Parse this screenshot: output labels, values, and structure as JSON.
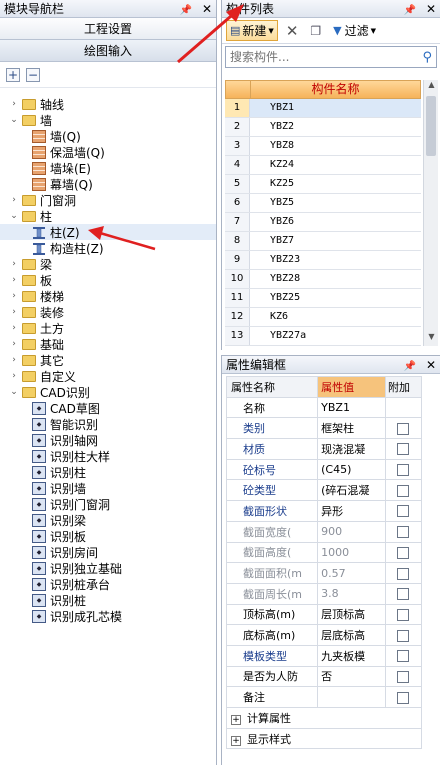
{
  "left_panel": {
    "title": "模块导航栏",
    "tabs": [
      "工程设置",
      "绘图输入"
    ],
    "tree": [
      {
        "label": "轴线",
        "type": "folder",
        "state": "collapsed",
        "level": 0
      },
      {
        "label": "墙",
        "type": "folder",
        "state": "expanded",
        "level": 0
      },
      {
        "label": "墙(Q)",
        "type": "wall",
        "level": 1
      },
      {
        "label": "保温墙(Q)",
        "type": "wall",
        "level": 1
      },
      {
        "label": "墙垛(E)",
        "type": "wall",
        "level": 1
      },
      {
        "label": "幕墙(Q)",
        "type": "wall",
        "level": 1
      },
      {
        "label": "门窗洞",
        "type": "folder",
        "state": "collapsed",
        "level": 0
      },
      {
        "label": "柱",
        "type": "folder",
        "state": "expanded",
        "level": 0
      },
      {
        "label": "柱(Z)",
        "type": "column",
        "level": 1,
        "selected": true
      },
      {
        "label": "构造柱(Z)",
        "type": "column",
        "level": 1
      },
      {
        "label": "梁",
        "type": "folder",
        "state": "collapsed",
        "level": 0
      },
      {
        "label": "板",
        "type": "folder",
        "state": "collapsed",
        "level": 0
      },
      {
        "label": "楼梯",
        "type": "folder",
        "state": "collapsed",
        "level": 0
      },
      {
        "label": "装修",
        "type": "folder",
        "state": "collapsed",
        "level": 0
      },
      {
        "label": "土方",
        "type": "folder",
        "state": "collapsed",
        "level": 0
      },
      {
        "label": "基础",
        "type": "folder",
        "state": "collapsed",
        "level": 0
      },
      {
        "label": "其它",
        "type": "folder",
        "state": "collapsed",
        "level": 0
      },
      {
        "label": "自定义",
        "type": "folder",
        "state": "collapsed",
        "level": 0
      },
      {
        "label": "CAD识别",
        "type": "folder",
        "state": "expanded",
        "level": 0
      },
      {
        "label": "CAD草图",
        "type": "cad",
        "level": 1
      },
      {
        "label": "智能识别",
        "type": "cad",
        "level": 1
      },
      {
        "label": "识别轴网",
        "type": "cad",
        "level": 1
      },
      {
        "label": "识别柱大样",
        "type": "cad",
        "level": 1
      },
      {
        "label": "识别柱",
        "type": "cad",
        "level": 1
      },
      {
        "label": "识别墙",
        "type": "cad",
        "level": 1
      },
      {
        "label": "识别门窗洞",
        "type": "cad",
        "level": 1
      },
      {
        "label": "识别梁",
        "type": "cad",
        "level": 1
      },
      {
        "label": "识别板",
        "type": "cad",
        "level": 1
      },
      {
        "label": "识别房间",
        "type": "cad",
        "level": 1
      },
      {
        "label": "识别独立基础",
        "type": "cad",
        "level": 1
      },
      {
        "label": "识别桩承台",
        "type": "cad",
        "level": 1
      },
      {
        "label": "识别桩",
        "type": "cad",
        "level": 1
      },
      {
        "label": "识别成孔芯模",
        "type": "cad",
        "level": 1
      }
    ]
  },
  "component_list": {
    "title": "构件列表",
    "new_label": "新建",
    "filter_label": "过滤",
    "search_placeholder": "搜索构件...",
    "column_header": "构件名称",
    "rows": [
      "YBZ1",
      "YBZ2",
      "YBZ8",
      "KZ24",
      "KZ25",
      "YBZ5",
      "YBZ6",
      "YBZ7",
      "YBZ23",
      "YBZ28",
      "YBZ25",
      "KZ6",
      "YBZ27a"
    ]
  },
  "properties": {
    "title": "属性编辑框",
    "headers": [
      "属性名称",
      "属性值",
      "附加"
    ],
    "rows": [
      {
        "name": "名称",
        "value": "YBZ1",
        "checkbox": false,
        "style": "normal"
      },
      {
        "name": "类别",
        "value": "框架柱",
        "checkbox": true,
        "style": "blue"
      },
      {
        "name": "材质",
        "value": "现浇混凝",
        "checkbox": true,
        "style": "blue"
      },
      {
        "name": "砼标号",
        "value": "(C45)",
        "checkbox": true,
        "style": "blue"
      },
      {
        "name": "砼类型",
        "value": "(碎石混凝",
        "checkbox": true,
        "style": "blue"
      },
      {
        "name": "截面形状",
        "value": "异形",
        "checkbox": true,
        "style": "blue"
      },
      {
        "name": "截面宽度(",
        "value": "900",
        "checkbox": true,
        "style": "gray"
      },
      {
        "name": "截面高度(",
        "value": "1000",
        "checkbox": true,
        "style": "gray"
      },
      {
        "name": "截面面积(m",
        "value": "0.57",
        "checkbox": true,
        "style": "gray"
      },
      {
        "name": "截面周长(m",
        "value": "3.8",
        "checkbox": true,
        "style": "gray"
      },
      {
        "name": "顶标高(m)",
        "value": "层顶标高",
        "checkbox": true,
        "style": "normal"
      },
      {
        "name": "底标高(m)",
        "value": "层底标高",
        "checkbox": true,
        "style": "normal"
      },
      {
        "name": "模板类型",
        "value": "九夹板模",
        "checkbox": true,
        "style": "blue"
      },
      {
        "name": "是否为人防",
        "value": "否",
        "checkbox": true,
        "style": "normal"
      },
      {
        "name": "备注",
        "value": "",
        "checkbox": true,
        "style": "normal"
      }
    ],
    "groups": [
      "计算属性",
      "显示样式"
    ]
  },
  "icons": {
    "pin": "pin-icon",
    "close": "close-icon",
    "new": "new-icon",
    "delete": "delete-icon",
    "copy": "copy-icon",
    "filter": "filter-icon",
    "search": "search-icon",
    "expand_all": "plus-icon",
    "collapse_all": "minus-icon"
  },
  "colors": {
    "header_orange": "#f6c37c",
    "header_red_text": "#c00000",
    "annotation_red": "#e02020"
  }
}
